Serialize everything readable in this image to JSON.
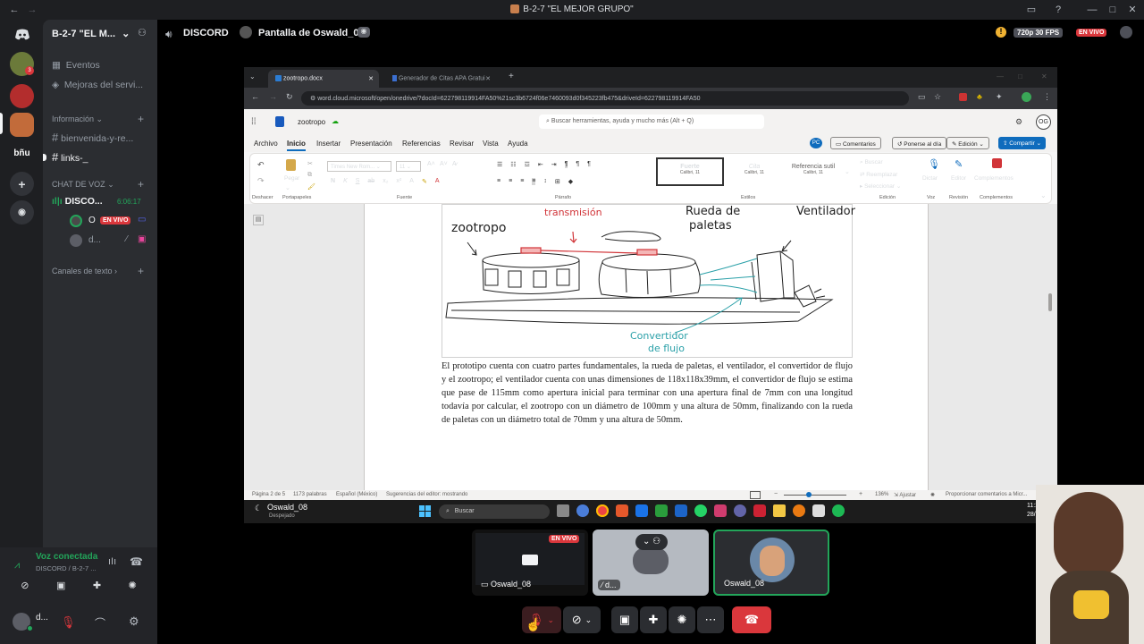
{
  "window": {
    "title": "B-2-7 \"EL MEJOR GRUPO\""
  },
  "server": {
    "name": "B-2-7 \"EL M...",
    "events_label": "Eventos",
    "boost_label": "Mejoras del servi...",
    "info_category": "Información",
    "text_channels": [
      "bienvenida-y-re...",
      "links-_"
    ],
    "voice_category": "CHAT DE VOZ",
    "voice_channel": {
      "name": "DISCO...",
      "timer": "6:06:17"
    },
    "voice_users": [
      {
        "name": "O",
        "badge": "EN VIVO"
      },
      {
        "name": "d..."
      }
    ],
    "text_category": "Canales de texto",
    "rail_label": "bñu"
  },
  "user_panel": {
    "status": "Voz conectada",
    "location": "DISCORD / B-2-7 ...",
    "username": "d..."
  },
  "stage": {
    "channel": "DISCORD",
    "screen_title": "Pantalla de Oswald_08",
    "quality": "720p 30 FPS",
    "live": "EN VIVO"
  },
  "browser": {
    "tabs": [
      {
        "label": "zootropo.docx",
        "active": true
      },
      {
        "label": "Generador de Citas APA Gratui",
        "active": false
      }
    ],
    "url": "word.cloud.microsoft/open/onedrive/?docId=622798119914FA50%21sc3b6724f06e7460093d0f345223fb475&driveId=622798119914FA50"
  },
  "word": {
    "doc_name": "zootropo",
    "search_placeholder": "Buscar herramientas, ayuda y mucho más (Alt + Q)",
    "buttons": {
      "comments": "Comentarios",
      "catchup": "Ponerse al día",
      "editing": "Edición",
      "share": "Compartir",
      "user": "PC"
    },
    "menu": [
      "Archivo",
      "Inicio",
      "Insertar",
      "Presentación",
      "Referencias",
      "Revisar",
      "Vista",
      "Ayuda"
    ],
    "ribbon": {
      "undo": "Deshacer",
      "paste": "Pegar",
      "clipboard": "Portapapeles",
      "font": "Times New Rom...",
      "font_size": "11",
      "font_group": "Fuente",
      "paragraph_group": "Párrafo",
      "styles": [
        {
          "name": "Fuerte",
          "font": "Calibri, 11"
        },
        {
          "name": "Cita",
          "font": "Calibri, 11"
        },
        {
          "name": "Referencia sutil",
          "font": "Calibri, 11"
        }
      ],
      "styles_group": "Estilos",
      "find": "Buscar",
      "replace": "Reemplazar",
      "select": "Seleccionar",
      "editing_group": "Edición",
      "dictate": "Dictar",
      "voice_group": "Voz",
      "editor": "Editor",
      "review_group": "Revisión",
      "addins": "Complementos",
      "addins_group": "Complementos"
    },
    "sketch_labels": {
      "transmission": "transmisión",
      "zootropo": "zootropo",
      "rueda": "Rueda de",
      "paletas": "paletas",
      "ventilador": "Ventilador",
      "convertidor": "Convertidor",
      "flujo": "de flujo"
    },
    "paragraph": "El prototipo cuenta con cuatro partes fundamentales, la rueda de paletas, el ventilador, el convertidor de flujo y el zootropo; el ventilador cuenta con unas dimensiones de 118x118x39mm, el convertidor de flujo se estima que pase de 115mm como apertura inicial para terminar con una apertura final de 7mm con una longitud todavía por calcular, el zootropo con un diámetro de 100mm y una altura de 50mm, finalizando con la rueda de paletas con un diámetro total de 70mm y una altura de 50mm.",
    "status": {
      "page": "Página 2 de 5",
      "words": "1173 palabras",
      "lang": "Español (México)",
      "editor": "Sugerencias del editor: mostrando",
      "zoom": "136%",
      "fit": "Ajustar",
      "feedback": "Proporcionar comentarios a Micr..."
    }
  },
  "taskbar": {
    "search": "Buscar",
    "time": "11:29",
    "date": "28/02/...",
    "weather_user": "Oswald_08",
    "weather_sub": "Despejado"
  },
  "participants": [
    {
      "name": "Oswald_08",
      "badge": "EN VIVO"
    },
    {
      "name": "d..."
    },
    {
      "name": "Oswald_08"
    }
  ],
  "colors": {
    "discord_bg": "#1e1f22",
    "sidebar": "#2b2d31",
    "live_red": "#da373c",
    "green": "#23a55a",
    "word_blue": "#0f6cbd"
  }
}
